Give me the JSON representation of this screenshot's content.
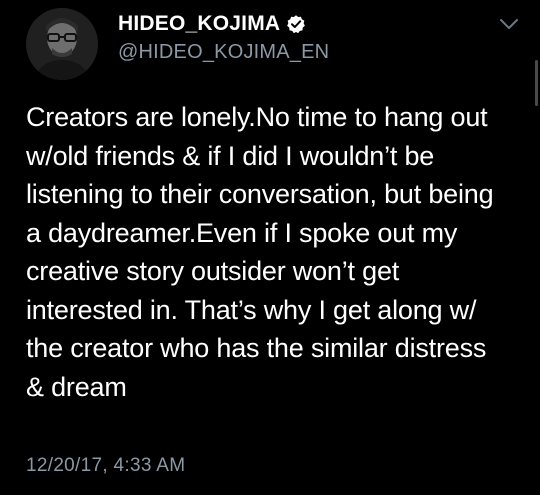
{
  "tweet": {
    "display_name": "HIDEO_KOJIMA",
    "handle": "@HIDEO_KOJIMA_EN",
    "verified": true,
    "body_lines": [
      "Creators are lonely.No time to hang out",
      "w/old friends & if I did I wouldn’t be",
      "listening to their conversation, but being",
      "a daydreamer.Even if I spoke out my",
      "creative story outsider won’t get",
      "interested in. That’s why I get along w/",
      "the creator who has the similar distress",
      "& dream"
    ],
    "timestamp": "12/20/17, 4:33 AM"
  },
  "icons": {
    "verified": "verified-badge-icon",
    "menu": "chevron-down-icon"
  },
  "colors": {
    "background": "#000000",
    "primary_text": "#ffffff",
    "secondary_text": "#8b98a5"
  }
}
